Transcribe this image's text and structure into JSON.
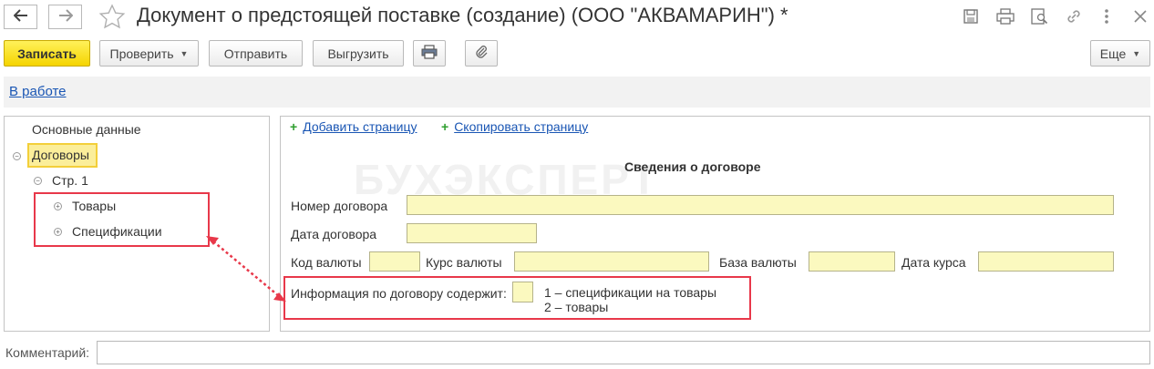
{
  "window": {
    "title": "Документ о предстоящей поставке (создание) (ООО \"АКВАМАРИН\") *",
    "icons": [
      "back-arrow-icon",
      "forward-arrow-icon",
      "star-icon",
      "save-icon",
      "print-icon",
      "preview-icon",
      "link-icon",
      "more-vert-icon",
      "close-icon"
    ]
  },
  "toolbar": {
    "save_label": "Записать",
    "check_label": "Проверить",
    "send_label": "Отправить",
    "export_label": "Выгрузить",
    "more_label": "Еще"
  },
  "status": {
    "link": "В работе"
  },
  "tree": {
    "items": [
      {
        "label": "Основные данные"
      },
      {
        "label": "Договоры"
      },
      {
        "label": "Стр. 1"
      },
      {
        "label": "Товары"
      },
      {
        "label": "Спецификации"
      }
    ]
  },
  "actions": {
    "add_page": "Добавить страницу",
    "copy_page": "Скопировать страницу"
  },
  "form": {
    "section_title": "Сведения о договоре",
    "contract_number_label": "Номер договора",
    "contract_date_label": "Дата договора",
    "currency_code_label": "Код валюты",
    "currency_rate_label": "Курс валюты",
    "currency_base_label": "База валюты",
    "rate_date_label": "Дата курса",
    "info_label": "Информация по договору содержит:",
    "info_option_1": "1 – спецификации на товары",
    "info_option_2": "2 – товары"
  },
  "watermark": "БУХЭКСПЕРТ",
  "comment": {
    "label": "Комментарий:",
    "value": ""
  },
  "colors": {
    "accent_yellow": "#f5d400",
    "field_yellow": "#fbf9bf",
    "highlight_red": "#e8384a",
    "link_blue": "#1a56b4"
  }
}
